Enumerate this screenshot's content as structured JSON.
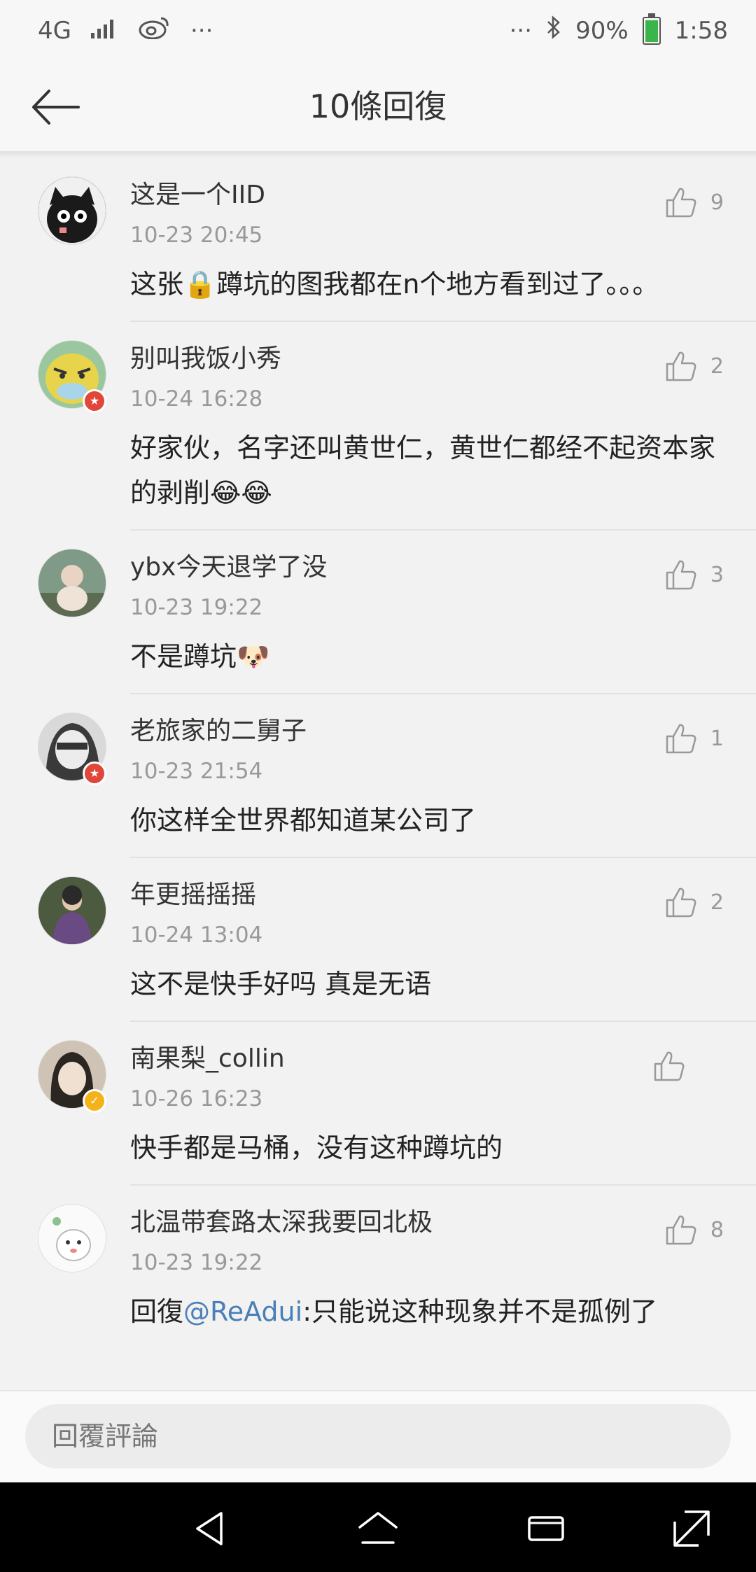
{
  "status_bar": {
    "network": "4G",
    "dots_left": "···",
    "dots_right": "···",
    "battery": "90%",
    "time": "1:58",
    "icons": [
      "signal-icon",
      "weibo-icon",
      "bluetooth-icon",
      "battery-icon"
    ]
  },
  "header": {
    "title": "10條回復",
    "back_icon": "back-arrow-icon"
  },
  "comments": [
    {
      "name": "这是一个IID",
      "time": "10-23 20:45",
      "likes": "9",
      "text": "这张🔒蹲坑的图我都在n个地方看到过了。。。",
      "avatar_color": "#1a1a1a"
    },
    {
      "name": "别叫我饭小秀",
      "time": "10-24 16:28",
      "likes": "2",
      "text": "好家伙，名字还叫黄世仁，黄世仁都经不起资本家的剥削😂😂",
      "avatar_color": "#e7d44a"
    },
    {
      "name": "ybx今天退学了没",
      "time": "10-23 19:22",
      "likes": "3",
      "text": "不是蹲坑🐶",
      "avatar_color": "#6a7f6a"
    },
    {
      "name": "老旅家的二舅子",
      "time": "10-23 21:54",
      "likes": "1",
      "text": "你这样全世界都知道某公司了",
      "avatar_color": "#cfcfcf"
    },
    {
      "name": "年更摇摇摇",
      "time": "10-24 13:04",
      "likes": "2",
      "text": "这不是快手好吗 真是无语",
      "avatar_color": "#5b4a66"
    },
    {
      "name": "南果梨_collin",
      "time": "10-26 16:23",
      "likes": "",
      "text": "快手都是马桶，没有这种蹲坑的",
      "avatar_color": "#d8c8b8"
    },
    {
      "name": "北温带套路太深我要回北极",
      "time": "10-23 19:22",
      "likes": "8",
      "text_prefix": "回復",
      "mention": "@ReAdui",
      "text": ":只能说这种现象并不是孤例了",
      "avatar_color": "#ffffff"
    }
  ],
  "reply_input": {
    "placeholder": "回覆評論"
  },
  "nav": {
    "icons": [
      "nav-back-icon",
      "nav-home-icon",
      "nav-recents-icon",
      "nav-expand-icon"
    ]
  },
  "colors": {
    "background": "#f2f2f2",
    "mention": "#4a7fb8",
    "meta": "#999999"
  }
}
